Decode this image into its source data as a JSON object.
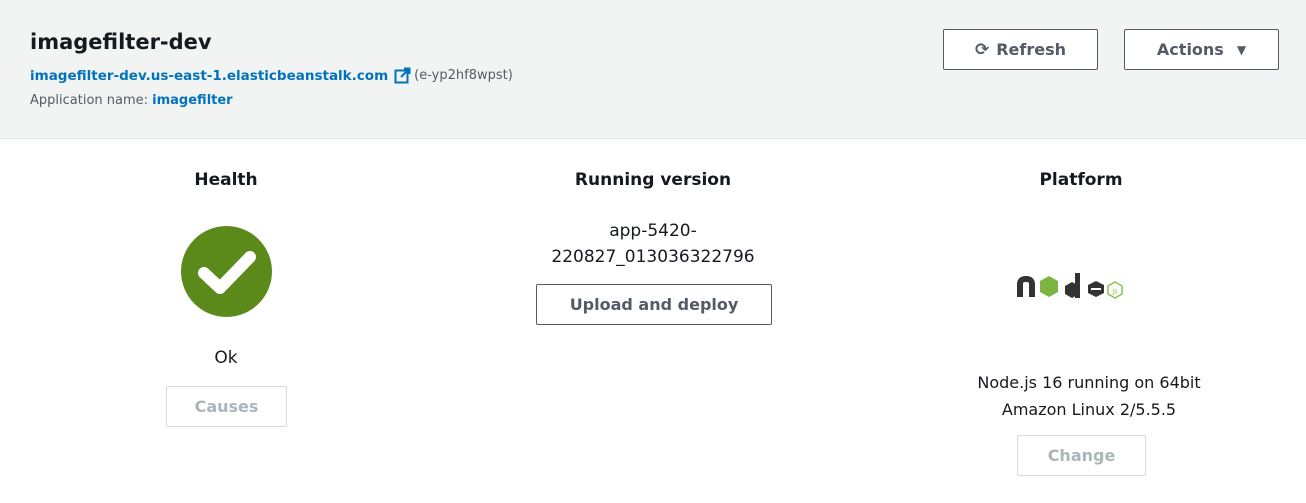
{
  "environment": {
    "name": "imagefilter-dev",
    "url": "imagefilter-dev.us-east-1.elasticbeanstalk.com",
    "env_id": "(e-yp2hf8wpst)",
    "app_label": "Application name:",
    "app_name": "imagefilter"
  },
  "toolbar": {
    "refresh_label": "Refresh",
    "actions_label": "Actions"
  },
  "health": {
    "title": "Health",
    "status": "Ok",
    "causes_label": "Causes",
    "color": "#5b8a1b"
  },
  "version": {
    "title": "Running version",
    "line1": "app-5420-",
    "line2": "220827_013036322796",
    "deploy_label": "Upload and deploy"
  },
  "platform": {
    "title": "Platform",
    "logo_text": "node",
    "logo_badge": "js",
    "line1": "Node.js 16 running on 64bit",
    "line2": "Amazon Linux 2/5.5.5",
    "change_label": "Change"
  },
  "icons": [
    "external-link-icon",
    "refresh-icon",
    "caret-down-icon",
    "check-circle-icon",
    "nodejs-logo"
  ]
}
